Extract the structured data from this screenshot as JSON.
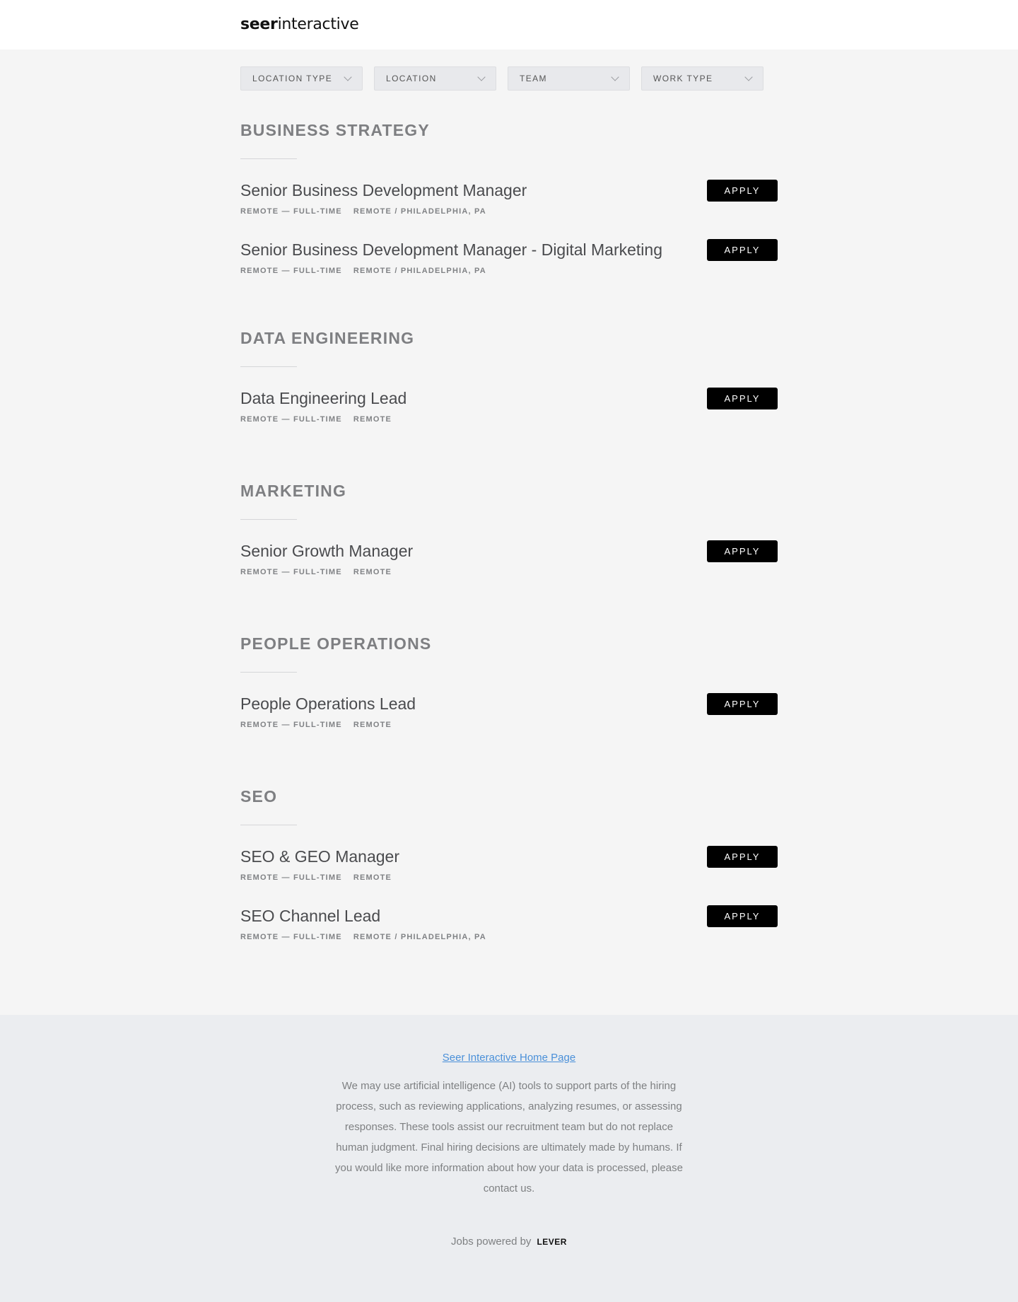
{
  "header": {
    "logo_bold": "seer",
    "logo_light": "interactive"
  },
  "filters": [
    {
      "label": "LOCATION TYPE"
    },
    {
      "label": "LOCATION"
    },
    {
      "label": "TEAM"
    },
    {
      "label": "WORK TYPE"
    }
  ],
  "groups": [
    {
      "title": "BUSINESS STRATEGY",
      "postings": [
        {
          "title": "Senior Business Development Manager",
          "commitment": "REMOTE — FULL-TIME",
          "location": "REMOTE / PHILADELPHIA, PA",
          "apply": "APPLY"
        },
        {
          "title": "Senior Business Development Manager - Digital Marketing",
          "commitment": "REMOTE — FULL-TIME",
          "location": "REMOTE / PHILADELPHIA, PA",
          "apply": "APPLY"
        }
      ]
    },
    {
      "title": "DATA ENGINEERING",
      "postings": [
        {
          "title": "Data Engineering Lead",
          "commitment": "REMOTE — FULL-TIME",
          "location": "REMOTE",
          "apply": "APPLY"
        }
      ]
    },
    {
      "title": "MARKETING",
      "postings": [
        {
          "title": "Senior Growth Manager",
          "commitment": "REMOTE — FULL-TIME",
          "location": "REMOTE",
          "apply": "APPLY"
        }
      ]
    },
    {
      "title": "PEOPLE OPERATIONS",
      "postings": [
        {
          "title": "People Operations Lead",
          "commitment": "REMOTE — FULL-TIME",
          "location": "REMOTE",
          "apply": "APPLY"
        }
      ]
    },
    {
      "title": "SEO",
      "postings": [
        {
          "title": "SEO & GEO Manager",
          "commitment": "REMOTE — FULL-TIME",
          "location": "REMOTE",
          "apply": "APPLY"
        },
        {
          "title": "SEO Channel Lead",
          "commitment": "REMOTE — FULL-TIME",
          "location": "REMOTE / PHILADELPHIA, PA",
          "apply": "APPLY"
        }
      ]
    }
  ],
  "footer": {
    "home_link": "Seer Interactive Home Page",
    "disclaimer": "We may use artificial intelligence (AI) tools to support parts of the hiring process, such as reviewing applications, analyzing resumes, or assessing responses. These tools assist our recruitment team but do not replace human judgment. Final hiring decisions are ultimately made by humans. If you would like more information about how your data is processed, please contact us.",
    "powered_by": "Jobs powered by",
    "lever": "LEVER"
  },
  "colors": {
    "accent_link": "#4a90d9",
    "apply_bg": "#000000",
    "page_bg": "#f5f5f5",
    "footer_bg": "#ebedf0"
  }
}
